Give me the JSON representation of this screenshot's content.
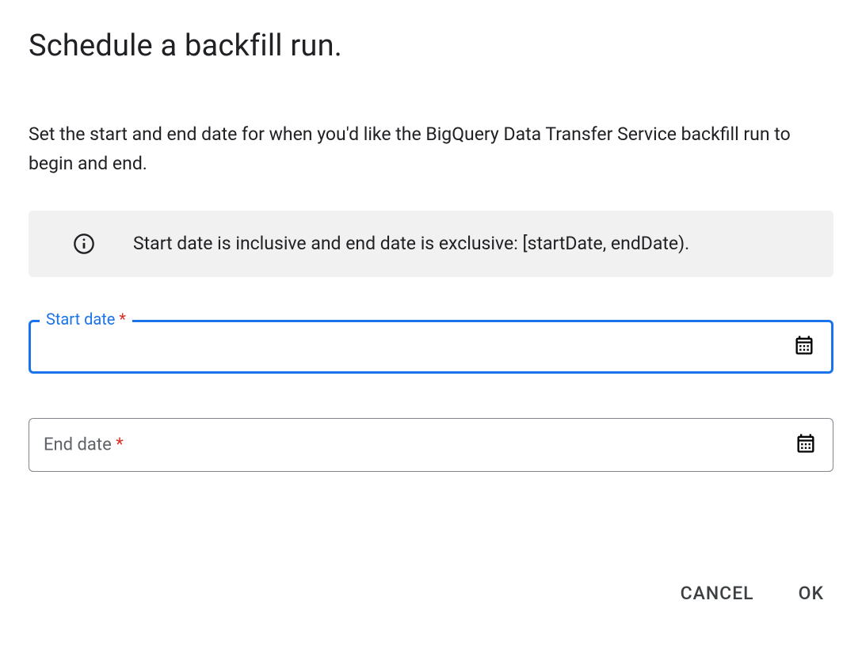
{
  "dialog": {
    "title": "Schedule a backfill run.",
    "description": "Set the start and end date for when you'd like the BigQuery Data Transfer Service backfill run to begin and end.",
    "info_text": "Start date is inclusive and end date is exclusive: [startDate, endDate)."
  },
  "fields": {
    "start_date": {
      "label": "Start date",
      "required_mark": "*",
      "value": ""
    },
    "end_date": {
      "label": "End date",
      "required_mark": "*",
      "value": ""
    }
  },
  "actions": {
    "cancel": "CANCEL",
    "ok": "OK"
  }
}
